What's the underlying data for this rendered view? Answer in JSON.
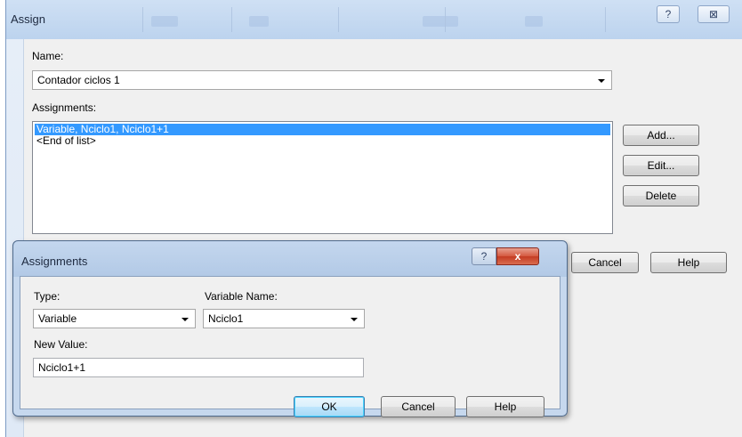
{
  "assign_dialog": {
    "title": "Assign",
    "help_icon": "?",
    "close_icon": "⊠",
    "name_label": "Name:",
    "name_value": "Contador ciclos 1",
    "assignments_label": "Assignments:",
    "assignments": [
      {
        "text": "Variable, Nciclo1, Nciclo1+1",
        "selected": true
      },
      {
        "text": "<End of list>",
        "selected": false
      }
    ],
    "add_label": "Add...",
    "edit_label": "Edit...",
    "delete_label": "Delete",
    "cancel_label": "Cancel",
    "help_label": "Help"
  },
  "assignments_dialog": {
    "title": "Assignments",
    "help_icon": "?",
    "close_icon": "x",
    "type_label": "Type:",
    "type_value": "Variable",
    "variable_name_label": "Variable Name:",
    "variable_name_value": "Nciclo1",
    "new_value_label": "New Value:",
    "new_value": "Nciclo1+1",
    "ok_label": "OK",
    "cancel_label": "Cancel",
    "help_label": "Help"
  },
  "colors": {
    "selection": "#3399ff",
    "window_frame": "#bcd3ee",
    "close_button": "#c43b22"
  }
}
